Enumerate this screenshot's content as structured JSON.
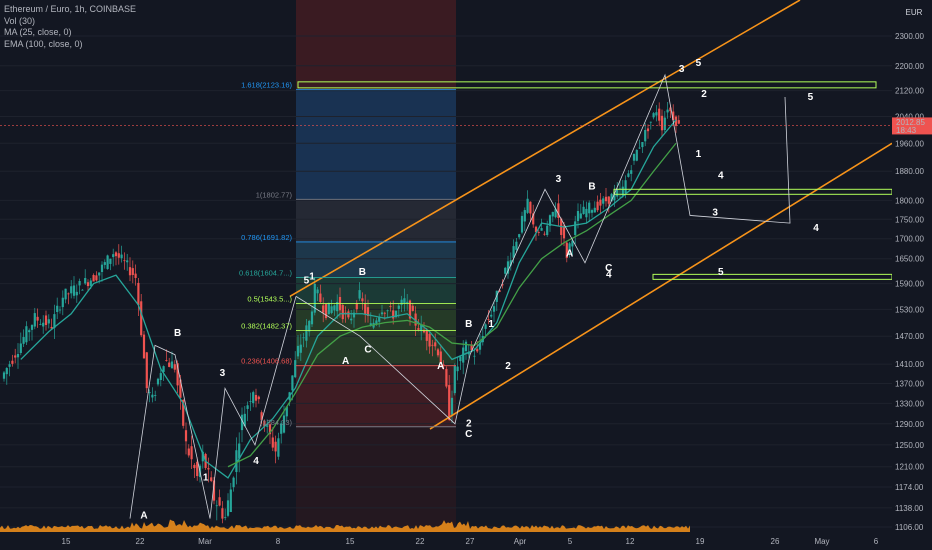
{
  "legend": {
    "title": "Ethereum / Euro, 1h, COINBASE",
    "vol": "Vol (30)",
    "ma": "MA (25, close, 0)",
    "ema": "EMA (100, close, 0)"
  },
  "currency_badge": "EUR",
  "colors": {
    "background": "#131722",
    "channel": "#f7931a",
    "ma": "#26a69a",
    "ema": "#43a047",
    "candle_up": "#26a69a",
    "candle_down": "#ef5350",
    "volume": "#f7931a",
    "price_tag": "#ef5350",
    "zone": "#b2ff59"
  },
  "chart_data": {
    "type": "candlestick",
    "symbol": "Ethereum / Euro",
    "interval": "1h",
    "exchange": "COINBASE",
    "ylim": [
      1090,
      2450
    ],
    "y_ticks": [
      "2300.00",
      "2200.00",
      "2120.00",
      "2040.00",
      "1960.00",
      "1880.00",
      "1800.00",
      "1750.00",
      "1700.00",
      "1650.00",
      "1590.00",
      "1530.00",
      "1470.00",
      "1410.00",
      "1370.00",
      "1330.00",
      "1290.00",
      "1250.00",
      "1210.00",
      "1174.00",
      "1138.00",
      "1106.00"
    ],
    "x_ticks": [
      "15",
      "22",
      "Mar",
      "8",
      "15",
      "22",
      "27",
      "Apr",
      "5",
      "12",
      "19",
      "26",
      "May",
      "6"
    ],
    "current_price": {
      "value": "2012.85",
      "countdown": "18:43"
    },
    "price_path": [
      [
        0,
        1380
      ],
      [
        3,
        1445
      ],
      [
        6,
        1510
      ],
      [
        9,
        1495
      ],
      [
        11,
        1560
      ],
      [
        14,
        1585
      ],
      [
        17,
        1610
      ],
      [
        20,
        1665
      ],
      [
        22,
        1640
      ],
      [
        24,
        1605
      ],
      [
        26,
        1360
      ],
      [
        27,
        1335
      ],
      [
        29,
        1420
      ],
      [
        31,
        1405
      ],
      [
        33,
        1250
      ],
      [
        35,
        1190
      ],
      [
        36,
        1230
      ],
      [
        38,
        1155
      ],
      [
        40,
        1122
      ],
      [
        41,
        1170
      ],
      [
        43,
        1300
      ],
      [
        45,
        1360
      ],
      [
        47,
        1290
      ],
      [
        49,
        1240
      ],
      [
        51,
        1330
      ],
      [
        53,
        1440
      ],
      [
        55,
        1500
      ],
      [
        56,
        1575
      ],
      [
        58,
        1525
      ],
      [
        60,
        1545
      ],
      [
        62,
        1500
      ],
      [
        64,
        1560
      ],
      [
        66,
        1490
      ],
      [
        68,
        1535
      ],
      [
        70,
        1520
      ],
      [
        72,
        1548
      ],
      [
        74,
        1500
      ],
      [
        76,
        1470
      ],
      [
        78,
        1440
      ],
      [
        79,
        1395
      ],
      [
        80,
        1310
      ],
      [
        81,
        1395
      ],
      [
        83,
        1445
      ],
      [
        85,
        1430
      ],
      [
        86,
        1480
      ],
      [
        88,
        1540
      ],
      [
        90,
        1620
      ],
      [
        92,
        1700
      ],
      [
        94,
        1790
      ],
      [
        95,
        1730
      ],
      [
        97,
        1710
      ],
      [
        99,
        1785
      ],
      [
        101,
        1660
      ],
      [
        103,
        1760
      ],
      [
        105,
        1780
      ],
      [
        107,
        1790
      ],
      [
        109,
        1810
      ],
      [
        111,
        1830
      ],
      [
        113,
        1920
      ],
      [
        115,
        1990
      ],
      [
        117,
        2060
      ],
      [
        118,
        2010
      ],
      [
        119,
        2070
      ],
      [
        120,
        2040
      ],
      [
        121,
        2012
      ]
    ],
    "ma_25": [
      [
        3,
        1420
      ],
      [
        8,
        1480
      ],
      [
        12,
        1520
      ],
      [
        16,
        1590
      ],
      [
        20,
        1610
      ],
      [
        24,
        1540
      ],
      [
        28,
        1400
      ],
      [
        32,
        1330
      ],
      [
        36,
        1220
      ],
      [
        40,
        1190
      ],
      [
        44,
        1260
      ],
      [
        48,
        1300
      ],
      [
        52,
        1360
      ],
      [
        56,
        1470
      ],
      [
        60,
        1520
      ],
      [
        64,
        1520
      ],
      [
        68,
        1510
      ],
      [
        72,
        1520
      ],
      [
        76,
        1480
      ],
      [
        80,
        1420
      ],
      [
        84,
        1440
      ],
      [
        88,
        1500
      ],
      [
        92,
        1640
      ],
      [
        96,
        1740
      ],
      [
        100,
        1730
      ],
      [
        104,
        1740
      ],
      [
        108,
        1780
      ],
      [
        112,
        1830
      ],
      [
        116,
        1950
      ],
      [
        120,
        2030
      ]
    ],
    "ema_100": [
      [
        40,
        1210
      ],
      [
        44,
        1230
      ],
      [
        48,
        1280
      ],
      [
        52,
        1350
      ],
      [
        56,
        1430
      ],
      [
        60,
        1470
      ],
      [
        64,
        1490
      ],
      [
        68,
        1500
      ],
      [
        72,
        1505
      ],
      [
        76,
        1490
      ],
      [
        80,
        1455
      ],
      [
        84,
        1450
      ],
      [
        88,
        1490
      ],
      [
        92,
        1580
      ],
      [
        96,
        1650
      ],
      [
        100,
        1690
      ],
      [
        104,
        1720
      ],
      [
        108,
        1760
      ],
      [
        112,
        1800
      ],
      [
        116,
        1880
      ],
      [
        120,
        1960
      ]
    ],
    "fibonacci": [
      {
        "label": "1.618(2123.16)",
        "price": 2123.16,
        "color": "#2196f3"
      },
      {
        "label": "1(1802.77)",
        "price": 1802.77,
        "color": "#787b86"
      },
      {
        "label": "0.786(1691.82)",
        "price": 1691.82,
        "color": "#2196f3"
      },
      {
        "label": "0.618(1604.7...)",
        "price": 1604.7,
        "color": "#26a69a"
      },
      {
        "label": "0.5(1543.5...)",
        "price": 1543.5,
        "color": "#b2ff59"
      },
      {
        "label": "0.382(1482.37)",
        "price": 1482.37,
        "color": "#b2ff59"
      },
      {
        "label": "0.236(1406.68)",
        "price": 1406.68,
        "color": "#ef5350"
      },
      {
        "label": "(1284.33)",
        "price": 1284.33,
        "color": "#787b86"
      }
    ],
    "wave_labels": [
      {
        "text": "1",
        "t": 55,
        "p": 1600
      },
      {
        "text": "5",
        "t": 54,
        "p": 1590
      },
      {
        "text": "B",
        "t": 64,
        "p": 1610
      },
      {
        "text": "A",
        "t": 61,
        "p": 1410
      },
      {
        "text": "C",
        "t": 65,
        "p": 1435
      },
      {
        "text": "A",
        "t": 78,
        "p": 1400
      },
      {
        "text": "B",
        "t": 83,
        "p": 1490
      },
      {
        "text": "1",
        "t": 87,
        "p": 1490
      },
      {
        "text": "2",
        "t": 90,
        "p": 1400
      },
      {
        "text": "2",
        "t": 83,
        "p": 1285
      },
      {
        "text": "C",
        "t": 83,
        "p": 1265
      },
      {
        "text": "3",
        "t": 99,
        "p": 1850
      },
      {
        "text": "B",
        "t": 105,
        "p": 1830
      },
      {
        "text": "A",
        "t": 101,
        "p": 1655
      },
      {
        "text": "C",
        "t": 108,
        "p": 1620
      },
      {
        "text": "4",
        "t": 108,
        "p": 1605
      },
      {
        "text": "3",
        "t": 121,
        "p": 2180
      },
      {
        "text": "5",
        "t": 124,
        "p": 2200
      },
      {
        "text": "2",
        "t": 125,
        "p": 2100
      },
      {
        "text": "1",
        "t": 124,
        "p": 1920
      },
      {
        "text": "4",
        "t": 128,
        "p": 1860
      },
      {
        "text": "3",
        "t": 127,
        "p": 1760
      },
      {
        "text": "5",
        "t": 128,
        "p": 1610
      },
      {
        "text": "5",
        "t": 144,
        "p": 2090
      },
      {
        "text": "4",
        "t": 145,
        "p": 1720
      },
      {
        "text": "B",
        "t": 31,
        "p": 1470
      },
      {
        "text": "3",
        "t": 39,
        "p": 1385
      },
      {
        "text": "4",
        "t": 45,
        "p": 1215
      },
      {
        "text": "1",
        "t": 36,
        "p": 1185
      },
      {
        "text": "A",
        "t": 25,
        "p": 1120
      }
    ]
  }
}
